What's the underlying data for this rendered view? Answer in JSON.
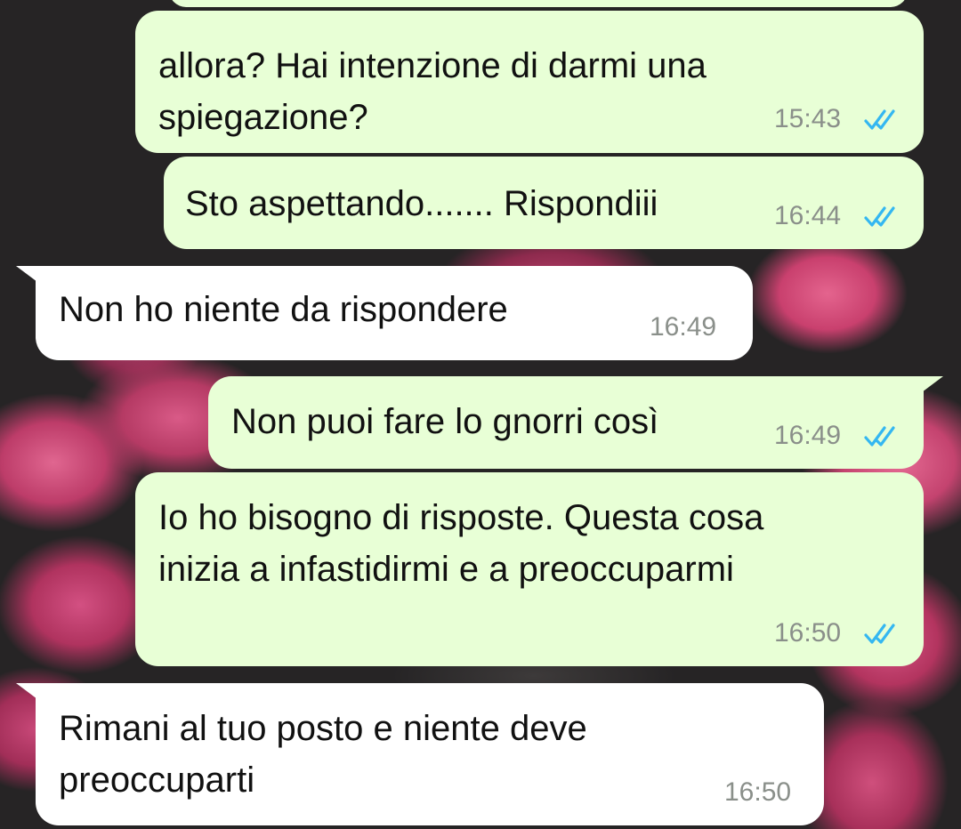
{
  "chat": {
    "messages": [
      {
        "direction": "outgoing",
        "text": "allora? Hai intenzione di darmi una\nspiegazione?",
        "time": "15:43",
        "status": "read-double-check"
      },
      {
        "direction": "outgoing",
        "text": "Sto aspettando....... Rispondiii",
        "time": "16:44",
        "status": "read-double-check"
      },
      {
        "direction": "incoming",
        "text": "Non ho niente da rispondere",
        "time": "16:49"
      },
      {
        "direction": "outgoing",
        "text": "Non puoi fare lo gnorri così",
        "time": "16:49",
        "status": "read-double-check"
      },
      {
        "direction": "outgoing",
        "text": "Io ho bisogno di risposte. Questa cosa\ninizia a infastidirmi e a preoccuparmi",
        "time": "16:50",
        "status": "read-double-check"
      },
      {
        "direction": "incoming",
        "text": "Rimani al tuo posto e niente deve\npreoccuparti",
        "time": "16:50"
      }
    ]
  },
  "colors": {
    "outgoing_bubble": "#e8ffd6",
    "incoming_bubble": "#ffffff",
    "read_ticks": "#34b7f1",
    "timestamp": "#8a8f8a",
    "text": "#111111"
  },
  "icons": {
    "status": "double-check-icon"
  }
}
